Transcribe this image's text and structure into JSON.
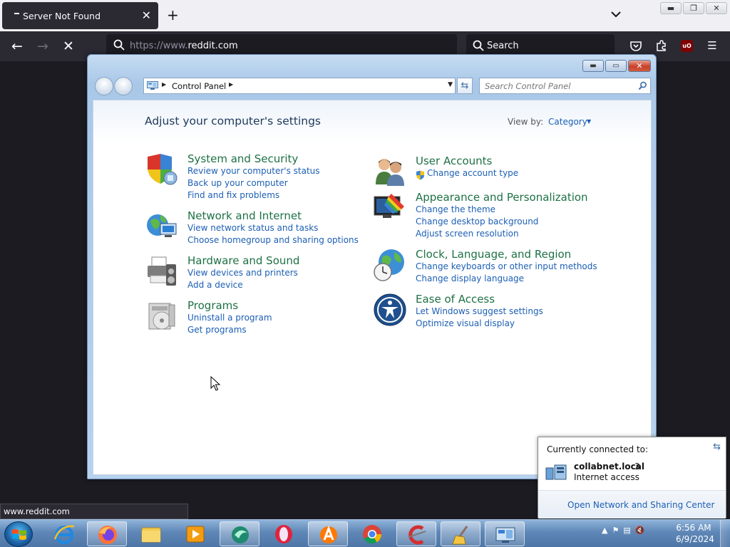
{
  "browser": {
    "tab_title": "Server Not Found",
    "new_tab_symbol": "+",
    "url_prefix": "https://www.",
    "url_domain": "reddit.com",
    "search_placeholder": "Search",
    "status_url": "www.reddit.com",
    "extension_badge": "uO"
  },
  "control_panel": {
    "breadcrumb": "Control Panel",
    "search_placeholder": "Search Control Panel",
    "heading": "Adjust your computer's settings",
    "view_by_label": "View by:",
    "view_by_value": "Category",
    "categories_left": [
      {
        "title": "System and Security",
        "links": [
          "Review your computer's status",
          "Back up your computer",
          "Find and fix problems"
        ],
        "icon": "shield-icon"
      },
      {
        "title": "Network and Internet",
        "links": [
          "View network status and tasks",
          "Choose homegroup and sharing options"
        ],
        "icon": "network-globe-icon"
      },
      {
        "title": "Hardware and Sound",
        "links": [
          "View devices and printers",
          "Add a device"
        ],
        "icon": "printer-icon"
      },
      {
        "title": "Programs",
        "links": [
          "Uninstall a program",
          "Get programs"
        ],
        "icon": "programs-disc-icon"
      }
    ],
    "categories_right": [
      {
        "title": "User Accounts",
        "links": [
          "Change account type"
        ],
        "icon": "users-icon"
      },
      {
        "title": "Appearance and Personalization",
        "links": [
          "Change the theme",
          "Change desktop background",
          "Adjust screen resolution"
        ],
        "icon": "monitor-paint-icon"
      },
      {
        "title": "Clock, Language, and Region",
        "links": [
          "Change keyboards or other input methods",
          "Change display language"
        ],
        "icon": "globe-clock-icon"
      },
      {
        "title": "Ease of Access",
        "links": [
          "Let Windows suggest settings",
          "Optimize visual display"
        ],
        "icon": "ease-of-access-icon"
      }
    ]
  },
  "network_flyout": {
    "header": "Currently connected to:",
    "network_name": "collabnet.local",
    "network_number": "3",
    "network_status": "Internet access",
    "open_link": "Open Network and Sharing Center"
  },
  "taskbar": {
    "apps": [
      "internet-explorer",
      "firefox",
      "file-explorer",
      "media-player",
      "kaspersky",
      "opera",
      "avast",
      "chrome",
      "ccleaner",
      "cleaner-broom",
      "control-panel"
    ],
    "time": "6:56 AM",
    "date": "6/9/2024"
  }
}
